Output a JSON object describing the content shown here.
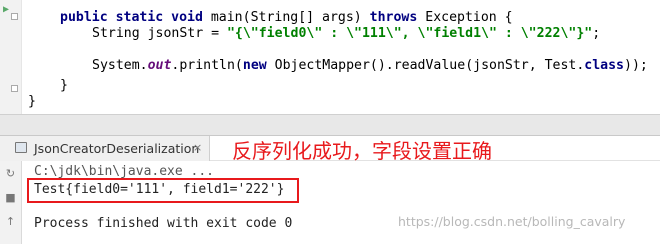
{
  "editor": {
    "line1": {
      "kw1": "public static void ",
      "method": "main",
      "params": "(String[] args) ",
      "kw2": "throws ",
      "rest": "Exception {"
    },
    "line2": {
      "decl": "String jsonStr = ",
      "literal": "\"{\\\"field0\\\" : \\\"111\\\", \\\"field1\\\" : \\\"222\\\"}\"",
      "end": ";"
    },
    "line3": {
      "part1": "System.",
      "field": "out",
      "part2": ".println(",
      "kw": "new ",
      "part3": "ObjectMapper().readValue(jsonStr, Test.",
      "kw2": "class",
      "part4": "));"
    },
    "line4": "}",
    "line5": "}"
  },
  "run": {
    "tab_label": "JsonCreatorDeserialization",
    "tab_close": "×",
    "command": "C:\\jdk\\bin\\java.exe ...",
    "result": "Test{field0='111', field1='222'}",
    "finish": "Process finished with exit code 0"
  },
  "annotation": "反序列化成功，字段设置正确",
  "watermark": "https://blog.csdn.net/bolling_cavalry",
  "colors": {
    "annotation": "#e8191c",
    "keyword": "#000080",
    "string": "#008000",
    "field": "#660e7a"
  }
}
